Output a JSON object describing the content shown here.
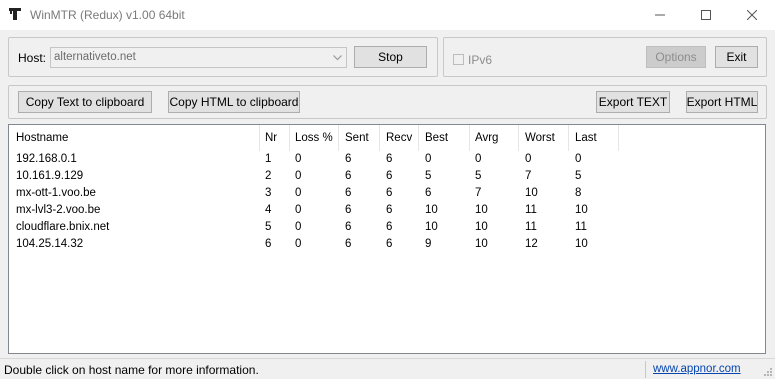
{
  "window": {
    "title": "WinMTR (Redux) v1.00 64bit",
    "icons": {
      "app": "winmtr-app-icon",
      "minimize": "minimize-icon",
      "maximize": "maximize-icon",
      "close": "close-icon"
    }
  },
  "host": {
    "label": "Host:",
    "value": "alternativeto.net",
    "dropdown_icon": "chevron-down-icon"
  },
  "buttons": {
    "stop": "Stop",
    "options": "Options",
    "exit": "Exit",
    "copy_text": "Copy Text to clipboard",
    "copy_html": "Copy HTML to clipboard",
    "export_text": "Export TEXT",
    "export_html": "Export HTML"
  },
  "ipv6": {
    "label": "IPv6",
    "checked": false,
    "enabled": false
  },
  "table": {
    "columns": [
      "Hostname",
      "Nr",
      "Loss %",
      "Sent",
      "Recv",
      "Best",
      "Avrg",
      "Worst",
      "Last"
    ],
    "rows": [
      [
        "192.168.0.1",
        "1",
        "0",
        "6",
        "6",
        "0",
        "0",
        "0",
        "0"
      ],
      [
        "10.161.9.129",
        "2",
        "0",
        "6",
        "6",
        "5",
        "5",
        "7",
        "5"
      ],
      [
        "mx-ott-1.voo.be",
        "3",
        "0",
        "6",
        "6",
        "6",
        "7",
        "10",
        "8"
      ],
      [
        "mx-lvl3-2.voo.be",
        "4",
        "0",
        "6",
        "6",
        "10",
        "10",
        "11",
        "10"
      ],
      [
        "cloudflare.bnix.net",
        "5",
        "0",
        "6",
        "6",
        "10",
        "10",
        "11",
        "11"
      ],
      [
        "104.25.14.32",
        "6",
        "0",
        "6",
        "6",
        "9",
        "10",
        "12",
        "10"
      ]
    ]
  },
  "status": {
    "text": "Double click on host name for more information.",
    "link": "www.appnor.com"
  },
  "colors": {
    "link": "#0645ad",
    "disabled_text": "#8d8d8d"
  }
}
